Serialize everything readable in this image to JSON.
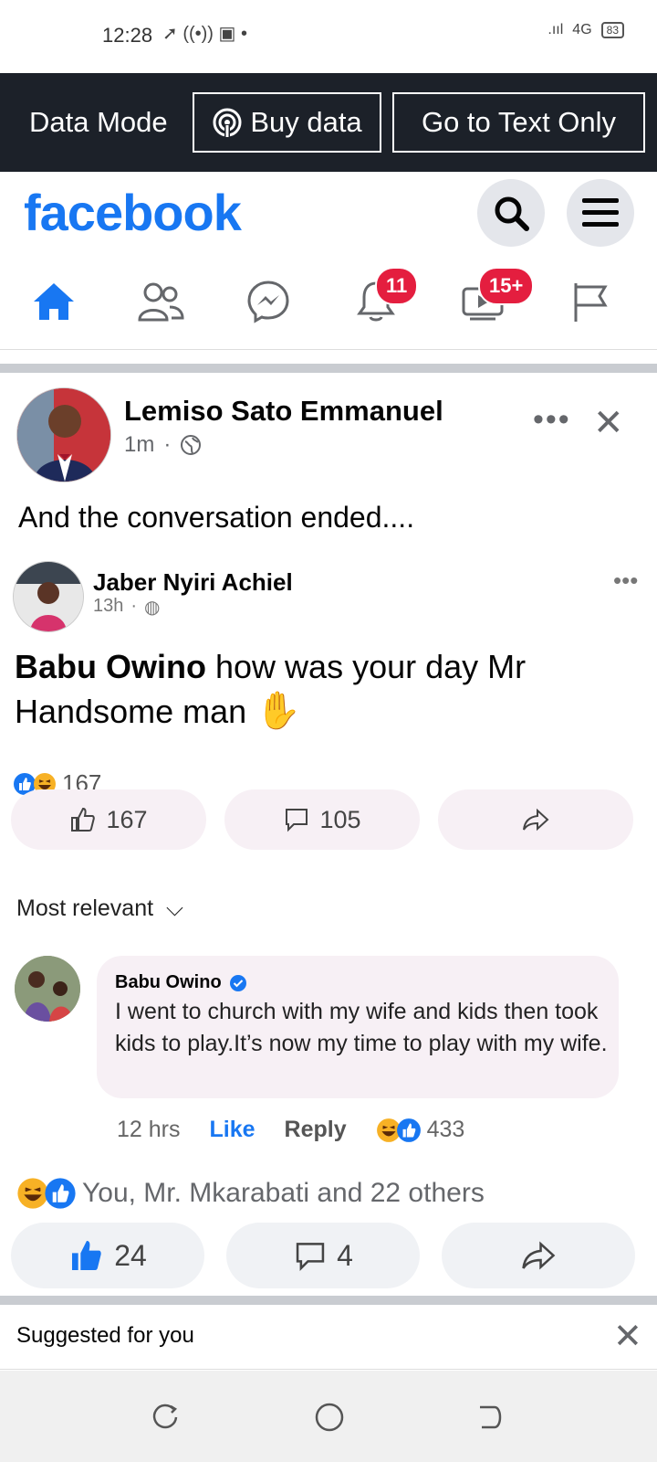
{
  "status_bar": {
    "time": "12:28",
    "network": "4G",
    "battery": "83"
  },
  "data_bar": {
    "mode_label": "Data Mode",
    "buy_data_label": "Buy data",
    "text_only_label": "Go to Text Only"
  },
  "header": {
    "logo": "facebook"
  },
  "nav": {
    "notifications_badge": "11",
    "video_badge": "15+"
  },
  "post": {
    "author": "Lemiso Sato Emmanuel",
    "time": "1m",
    "text": "And the conversation ended....",
    "shared": {
      "author": "Jaber Nyiri Achiel",
      "time": "13h",
      "quote_bold": "Babu Owino",
      "quote_rest": " how was your day Mr Handsome man",
      "reaction_count": "167",
      "like_count": "167",
      "comment_count": "105",
      "sort_label": "Most relevant",
      "comment": {
        "author": "Babu Owino",
        "text": "I went to church with my wife and kids then took kids to play.It’s now my time to play with my wife.",
        "time": "12 hrs",
        "like_label": "Like",
        "reply_label": "Reply",
        "reaction_count": "433"
      }
    },
    "reaction_summary": "You, Mr. Mkarabati and 22 others",
    "like_count": "24",
    "comment_count": "4"
  },
  "suggested": {
    "label": "Suggested for you"
  },
  "colors": {
    "brand": "#1877f2",
    "badge": "#e41e3f",
    "data_bar": "#1c2129"
  }
}
